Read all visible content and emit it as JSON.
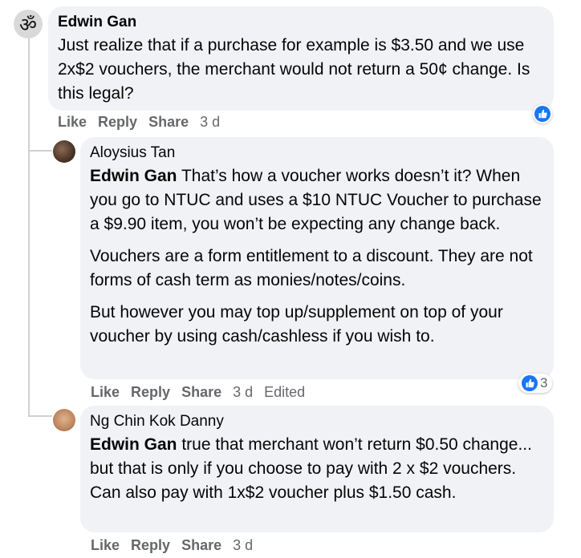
{
  "comments": [
    {
      "author": "Edwin Gan",
      "paragraphs": [
        {
          "mention": "",
          "text": "Just realize that if a purchase for example is $3.50 and we use 2x$2 vouchers, the merchant would not return a 50¢ change. Is this legal?"
        }
      ],
      "actions": {
        "like": "Like",
        "reply": "Share",
        "share": "",
        "time": "3 d",
        "edited": ""
      },
      "reaction_count": ""
    },
    {
      "author": "Aloysius Tan",
      "paragraphs": [
        {
          "mention": "Edwin Gan",
          "text": " That’s how a voucher works doesn’t it? When you go to NTUC and uses a $10 NTUC Voucher to purchase a $9.90 item, you won’t be expecting any change back."
        },
        {
          "mention": "",
          "text": "Vouchers are a form entitlement to a discount. They are not forms of cash term as monies/notes/coins."
        },
        {
          "mention": "",
          "text": "But however you may top up/supplement on top of your voucher by using cash/cashless if you wish to."
        }
      ],
      "actions": {
        "like": "Like",
        "reply": "Reply",
        "share": "Share",
        "time": "3 d",
        "edited": "Edited"
      },
      "reaction_count": "3"
    },
    {
      "author": "Ng Chin Kok Danny",
      "paragraphs": [
        {
          "mention": "Edwin Gan",
          "text": " true that merchant won’t return $0.50 change... but that is only if you choose to pay with 2 x $2 vouchers. Can also pay with 1x$2 voucher plus $1.50 cash."
        }
      ],
      "actions": {
        "like": "Like",
        "reply": "Reply",
        "share": "Share",
        "time": "3 d",
        "edited": ""
      },
      "reaction_count": ""
    }
  ],
  "first_actions": {
    "like": "Like",
    "reply": "Reply",
    "share": "Share",
    "time": "3 d"
  },
  "icons": {
    "om_avatar": "om-symbol-icon",
    "like_reaction": "thumbs-up-icon"
  },
  "colors": {
    "bubble": "#f0f2f5",
    "meta": "#65676b",
    "like_blue": "#1877f2"
  }
}
